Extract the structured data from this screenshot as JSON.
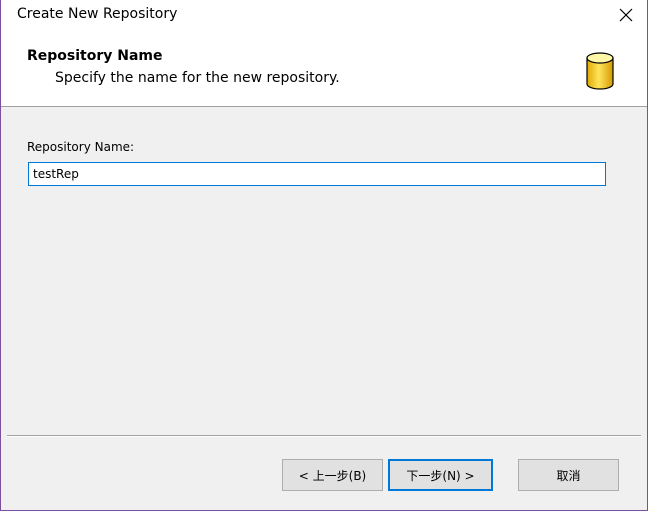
{
  "window": {
    "title": "Create New Repository"
  },
  "header": {
    "title": "Repository Name",
    "subtitle": "Specify the name for the new repository.",
    "icon": "database-icon"
  },
  "form": {
    "name_label": "Repository Name:",
    "name_value": "testRep"
  },
  "buttons": {
    "back_label": "< 上一步(B)",
    "next_label": "下一步(N) >",
    "cancel_label": "取消"
  },
  "colors": {
    "accent": "#0078d7",
    "window_border": "#7a4fa0",
    "content_bg": "#f0f0f0",
    "icon_yellow": "#f5c400"
  }
}
